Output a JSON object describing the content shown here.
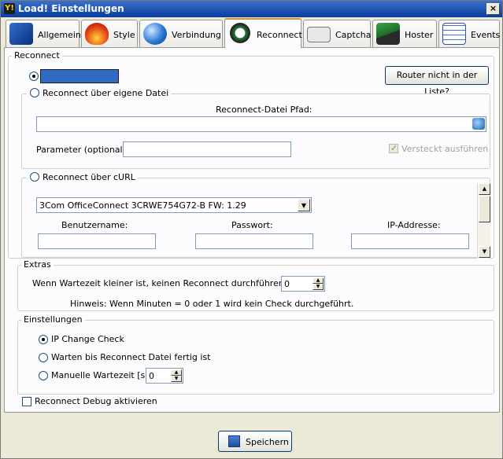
{
  "window": {
    "title": "Load! Einstellungen",
    "close_glyph": "×",
    "app_icon_glyph": "Y!"
  },
  "tabs": [
    {
      "label": "Allgemein",
      "icon": "person-card-icon"
    },
    {
      "label": "Style",
      "icon": "flame-icon"
    },
    {
      "label": "Verbindung",
      "icon": "globe-icon"
    },
    {
      "label": "Reconnect",
      "icon": "arrows-cycle-icon",
      "active": true
    },
    {
      "label": "Captcha",
      "icon": "captcha-icon"
    },
    {
      "label": "Hoster",
      "icon": "server-icon"
    },
    {
      "label": "Events",
      "icon": "calendar-icon"
    }
  ],
  "reconnect": {
    "legend": "Reconnect",
    "router_button": "Router nicht in der Liste?",
    "own_file": {
      "radio_label": "Reconnect über eigene Datei",
      "path_label": "Reconnect-Datei Pfad:",
      "path_value": "",
      "param_label": "Parameter (optional):",
      "param_value": "",
      "hidden_label": "Versteckt ausführen"
    },
    "curl": {
      "radio_label": "Reconnect über cURL",
      "router_select": "3Com OfficeConnect 3CRWE754G72-B FW: 1.29",
      "user_label": "Benutzername:",
      "pass_label": "Passwort:",
      "ip_label": "IP-Addresse:"
    }
  },
  "extras": {
    "legend": "Extras",
    "wait_label": "Wenn Wartezeit kleiner ist, keinen Reconnect durchführen [min]",
    "wait_value": "0",
    "hint": "Hinweis: Wenn Minuten = 0 oder 1 wird kein Check durchgeführt."
  },
  "settings": {
    "legend": "Einstellungen",
    "opt1": "IP Change Check",
    "opt2": "Warten bis Reconnect Datei fertig ist",
    "opt3": "Manuelle Wartezeit [s]",
    "manual_value": "0"
  },
  "debug_label": "Reconnect Debug aktivieren",
  "save_button": "Speichern",
  "colors": {
    "accent": "#e68b2c",
    "titlebar": "#0a3e9f",
    "selection": "#316ac5"
  }
}
